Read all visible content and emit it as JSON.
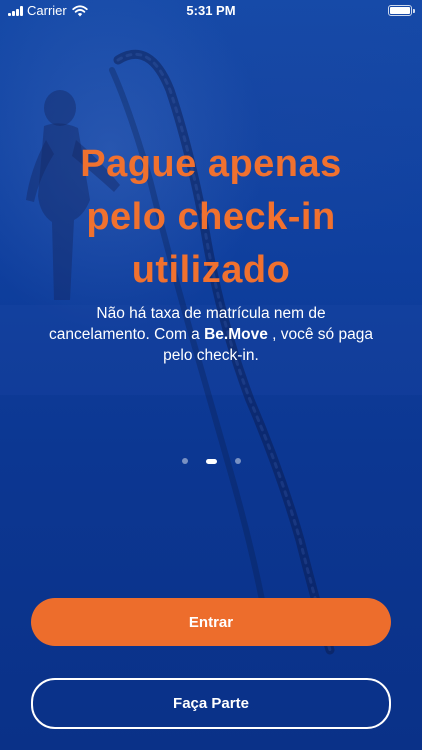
{
  "status_bar": {
    "carrier": "Carrier",
    "time": "5:31 PM"
  },
  "onboarding": {
    "headline_lines": [
      "Pague apenas",
      "pelo check-in",
      "utilizado"
    ],
    "description": {
      "line1": "Não há taxa de matrícula nem de",
      "line2_prefix": "cancelamento. Com a ",
      "brand": "Be.Move",
      "line2_suffix": " , você só paga",
      "line3": "pelo check-in."
    },
    "pagination": {
      "total": 3,
      "active_index": 1
    }
  },
  "actions": {
    "primary_label": "Entrar",
    "secondary_label": "Faça Parte"
  },
  "colors": {
    "accent": "#ED6D2C",
    "background": "#0F3F9E",
    "text": "#FFFFFF"
  }
}
